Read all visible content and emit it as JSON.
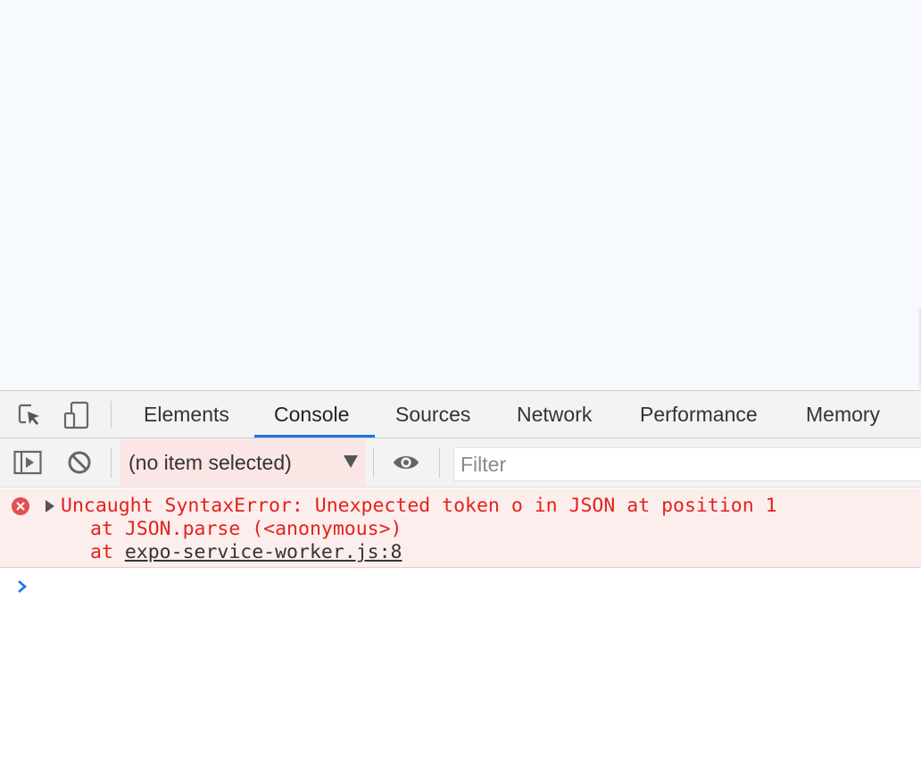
{
  "colors": {
    "viewport_bg": "#f6fafe",
    "active_tab_underline": "#1a73e8",
    "error_text": "#e2231a",
    "error_bg": "#fdeeee",
    "prompt": "#1a73e8"
  },
  "tabbar": {
    "icons": [
      "inspect-element-icon",
      "device-toolbar-icon"
    ],
    "tabs": [
      {
        "label": "Elements"
      },
      {
        "label": "Console",
        "active": true
      },
      {
        "label": "Sources"
      },
      {
        "label": "Network"
      },
      {
        "label": "Performance"
      },
      {
        "label": "Memory"
      }
    ]
  },
  "toolbar": {
    "icons": [
      "show-sidebar-icon",
      "clear-console-icon",
      "live-expression-eye-icon"
    ],
    "context_value": "(no item selected)",
    "filter_placeholder": "Filter"
  },
  "console": {
    "messages": [
      {
        "level": "error",
        "icon": "error-circle-icon",
        "text": "Uncaught SyntaxError: Unexpected token o in JSON at position 1",
        "stack": [
          {
            "prefix": "at ",
            "text": "JSON.parse (<anonymous>)"
          },
          {
            "prefix": "at ",
            "link": "expo-service-worker.js:8"
          }
        ]
      }
    ],
    "prompt_icon": "chevron-right-icon"
  }
}
